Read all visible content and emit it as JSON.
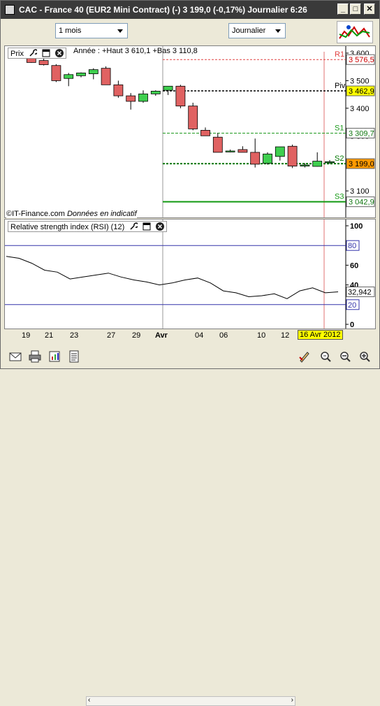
{
  "window": {
    "title": "CAC - France 40 (EUR2 Mini Contract) (-)   3 199,0 (-0,17%)   Journalier  6:26",
    "minimize": "_",
    "maximize": "□",
    "close": "✕"
  },
  "toolbar": {
    "period_select": "1 mois",
    "interval_select": "Journalier"
  },
  "price_panel": {
    "label": "Prix",
    "annee": "Année : +Haut 3 610,1 +Bas 3 110,8",
    "credit": "©IT-Finance.com",
    "credit_note": "Données en indicatif",
    "y_ticks": [
      "3 600",
      "3 500",
      "3 400",
      "3 300",
      "3 200",
      "3 100"
    ],
    "pivots": [
      {
        "name": "R1",
        "value": "3 576,5"
      },
      {
        "name": "Piv",
        "value": "3 462,9"
      },
      {
        "name": "S1",
        "value": "3 309,7"
      },
      {
        "name": "S2",
        "value": "3 199,0"
      },
      {
        "name": "S3",
        "value": "3 042,9"
      }
    ]
  },
  "rsi_panel": {
    "label": "Relative strength index (RSI) (12)",
    "y_ticks": [
      "100",
      "80",
      "60",
      "40",
      "20",
      "0"
    ],
    "last_value": "32,942",
    "band_high": "80",
    "band_low": "20"
  },
  "x_axis": {
    "labels": [
      "19",
      "21",
      "23",
      "27",
      "29",
      "Avr",
      "04",
      "06",
      "10",
      "12",
      "16 Avr 2012"
    ]
  },
  "chart_data": [
    {
      "type": "candlestick",
      "title": "Prix",
      "ylim": [
        3042,
        3625
      ],
      "candles": [
        {
          "o": 3596,
          "h": 3605,
          "l": 3583,
          "c": 3588
        },
        {
          "o": 3588,
          "h": 3598,
          "l": 3565,
          "c": 3566
        },
        {
          "o": 3573,
          "h": 3585,
          "l": 3555,
          "c": 3558
        },
        {
          "o": 3555,
          "h": 3560,
          "l": 3495,
          "c": 3500
        },
        {
          "o": 3508,
          "h": 3528,
          "l": 3480,
          "c": 3522
        },
        {
          "o": 3518,
          "h": 3530,
          "l": 3512,
          "c": 3528
        },
        {
          "o": 3525,
          "h": 3545,
          "l": 3505,
          "c": 3540
        },
        {
          "o": 3545,
          "h": 3552,
          "l": 3485,
          "c": 3485
        },
        {
          "o": 3485,
          "h": 3500,
          "l": 3438,
          "c": 3445
        },
        {
          "o": 3445,
          "h": 3455,
          "l": 3395,
          "c": 3425
        },
        {
          "o": 3425,
          "h": 3465,
          "l": 3420,
          "c": 3452
        },
        {
          "o": 3452,
          "h": 3465,
          "l": 3445,
          "c": 3462
        },
        {
          "o": 3465,
          "h": 3480,
          "l": 3448,
          "c": 3480
        },
        {
          "o": 3480,
          "h": 3485,
          "l": 3400,
          "c": 3408
        },
        {
          "o": 3408,
          "h": 3420,
          "l": 3320,
          "c": 3325
        },
        {
          "o": 3320,
          "h": 3330,
          "l": 3300,
          "c": 3300
        },
        {
          "o": 3295,
          "h": 3310,
          "l": 3240,
          "c": 3240
        },
        {
          "o": 3244,
          "h": 3250,
          "l": 3240,
          "c": 3245
        },
        {
          "o": 3250,
          "h": 3262,
          "l": 3240,
          "c": 3240
        },
        {
          "o": 3240,
          "h": 3290,
          "l": 3185,
          "c": 3197
        },
        {
          "o": 3200,
          "h": 3240,
          "l": 3195,
          "c": 3234
        },
        {
          "o": 3225,
          "h": 3260,
          "l": 3210,
          "c": 3260
        },
        {
          "o": 3262,
          "h": 3268,
          "l": 3183,
          "c": 3190
        },
        {
          "o": 3190,
          "h": 3200,
          "l": 3185,
          "c": 3194
        },
        {
          "o": 3189,
          "h": 3240,
          "l": 3188,
          "c": 3208
        },
        {
          "o": 3205,
          "h": 3212,
          "l": 3198,
          "c": 3206
        }
      ]
    },
    {
      "type": "line",
      "title": "Relative strength index (RSI) (12)",
      "ylim": [
        0,
        100
      ],
      "bands": [
        80,
        20
      ],
      "x": [
        0,
        2,
        4,
        6,
        8,
        10,
        12,
        14,
        16,
        18,
        20,
        22,
        24,
        26,
        28,
        30,
        32,
        34,
        36,
        38,
        40,
        42,
        44,
        46,
        48,
        50,
        52
      ],
      "series": [
        {
          "values": [
            69,
            67,
            62,
            55,
            53,
            46,
            48,
            50,
            52,
            48,
            45,
            43,
            40,
            42,
            45,
            47,
            42,
            34,
            32,
            28,
            29,
            31,
            26,
            34,
            37,
            32,
            33
          ]
        }
      ]
    }
  ]
}
